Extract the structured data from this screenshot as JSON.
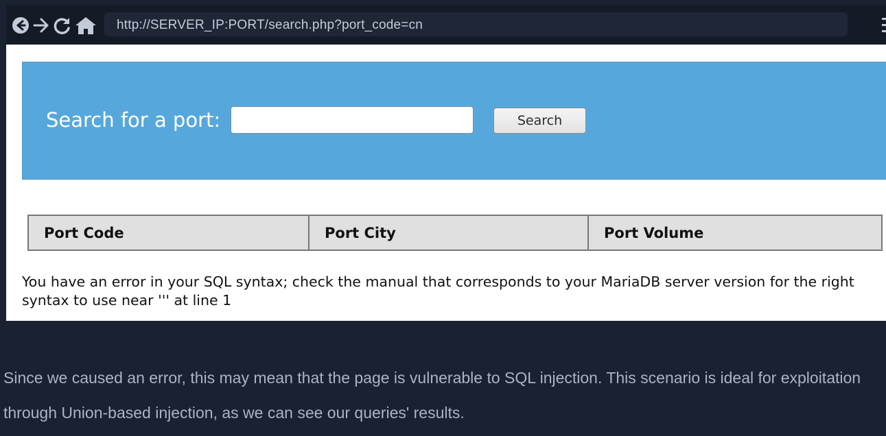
{
  "browser": {
    "url": "http://SERVER_IP:PORT/search.php?port_code=cn"
  },
  "search": {
    "label": "Search for a port:",
    "input_value": "",
    "button_label": "Search"
  },
  "table": {
    "columns": [
      "Port Code",
      "Port City",
      "Port Volume"
    ]
  },
  "error": {
    "message": "You have an error in your SQL syntax; check the manual that corresponds to your MariaDB server version for the right syntax to use near ''' at line 1"
  },
  "article": {
    "paragraph": "Since we caused an error, this may mean that the page is vulnerable to SQL injection. This scenario is ideal for exploitation through Union-based injection, as we can see our queries' results."
  },
  "colors": {
    "background": "#1a2130",
    "panel_blue": "#56a8dc",
    "table_header": "#e0e0e0"
  }
}
